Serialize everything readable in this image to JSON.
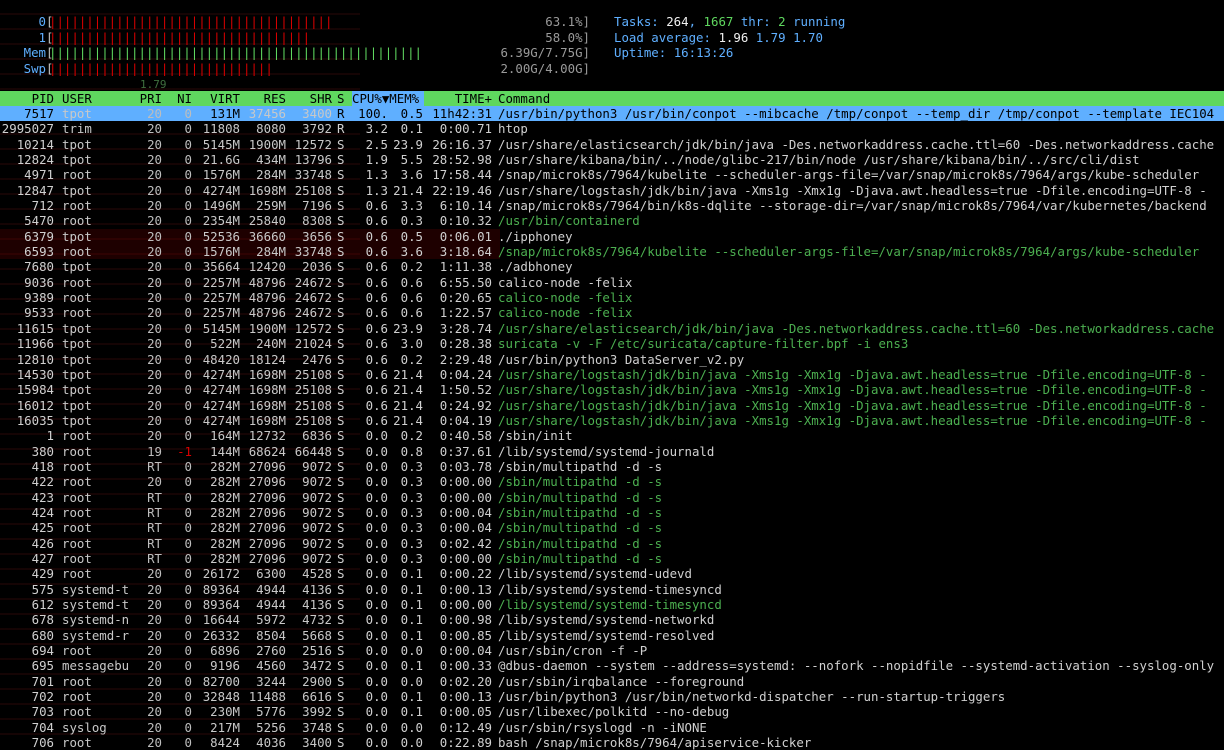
{
  "meters": [
    {
      "label": "0",
      "fraction": 0.631,
      "value": "63.1%]",
      "bar_color": "#d70000"
    },
    {
      "label": "1",
      "fraction": 0.58,
      "value": "58.0%]",
      "bar_color": "#d70000"
    },
    {
      "label": "Mem",
      "fraction": 0.826,
      "value": "6.39G/7.75G]",
      "bar_color": "#5fd75f"
    },
    {
      "label": "Swp",
      "fraction": 0.5,
      "value": "2.00G/4.00G]",
      "bar_color": "#d70000"
    }
  ],
  "summary": {
    "tasks_label": "Tasks: ",
    "tasks": "264",
    "thr_sep": ", ",
    "thr": "1667",
    "thr_label": " thr: ",
    "running": "2",
    "running_label": " running",
    "load_label": "Load average: ",
    "load1": "1.96",
    "load5": "1.79",
    "load15": "1.70",
    "uptime_label": "Uptime: ",
    "uptime": "16:13:26"
  },
  "ghost_text": "1.79",
  "columns": [
    "PID",
    "USER",
    "PRI",
    "NI",
    "VIRT",
    "RES",
    "SHR",
    "S",
    "CPU%▼MEM%",
    "TIME+",
    "Command"
  ],
  "colors": {
    "header_bg": "#5fd75f",
    "selected_bg": "#5fafff",
    "thread": "#4caf50",
    "accent_blue": "#5fafff"
  },
  "processes": [
    {
      "pid": "7517",
      "user": "tpot",
      "pri": "20",
      "ni": "0",
      "virt": "131M",
      "res": "37456",
      "shr": "3400",
      "s": "R",
      "cpu": "100.",
      "mem": "0.5",
      "time": "11h42:31",
      "cmd": "/usr/bin/python3 /usr/bin/conpot --mibcache /tmp/conpot --temp_dir /tmp/conpot --template IEC104",
      "sel": true
    },
    {
      "pid": "2995027",
      "user": "trim",
      "pri": "20",
      "ni": "0",
      "virt": "11808",
      "res": "8080",
      "shr": "3792",
      "s": "R",
      "cpu": "3.2",
      "mem": "0.1",
      "time": "0:00.71",
      "cmd": "htop"
    },
    {
      "pid": "10214",
      "user": "tpot",
      "pri": "20",
      "ni": "0",
      "virt": "5145M",
      "res": "1900M",
      "shr": "12572",
      "s": "S",
      "cpu": "2.5",
      "mem": "23.9",
      "time": "26:16.37",
      "cmd": "/usr/share/elasticsearch/jdk/bin/java -Des.networkaddress.cache.ttl=60 -Des.networkaddress.cache"
    },
    {
      "pid": "12824",
      "user": "tpot",
      "pri": "20",
      "ni": "0",
      "virt": "21.6G",
      "res": "434M",
      "shr": "13796",
      "s": "S",
      "cpu": "1.9",
      "mem": "5.5",
      "time": "28:52.98",
      "cmd": "/usr/share/kibana/bin/../node/glibc-217/bin/node /usr/share/kibana/bin/../src/cli/dist"
    },
    {
      "pid": "4971",
      "user": "root",
      "pri": "20",
      "ni": "0",
      "virt": "1576M",
      "res": "284M",
      "shr": "33748",
      "s": "S",
      "cpu": "1.3",
      "mem": "3.6",
      "time": "17:58.44",
      "cmd": "/snap/microk8s/7964/kubelite --scheduler-args-file=/var/snap/microk8s/7964/args/kube-scheduler"
    },
    {
      "pid": "12847",
      "user": "tpot",
      "pri": "20",
      "ni": "0",
      "virt": "4274M",
      "res": "1698M",
      "shr": "25108",
      "s": "S",
      "cpu": "1.3",
      "mem": "21.4",
      "time": "22:19.46",
      "cmd": "/usr/share/logstash/jdk/bin/java -Xms1g -Xmx1g -Djava.awt.headless=true -Dfile.encoding=UTF-8 -"
    },
    {
      "pid": "712",
      "user": "root",
      "pri": "20",
      "ni": "0",
      "virt": "1496M",
      "res": "259M",
      "shr": "7196",
      "s": "S",
      "cpu": "0.6",
      "mem": "3.3",
      "time": "6:10.14",
      "cmd": "/snap/microk8s/7964/bin/k8s-dqlite --storage-dir=/var/snap/microk8s/7964/var/kubernetes/backend"
    },
    {
      "pid": "5470",
      "user": "root",
      "pri": "20",
      "ni": "0",
      "virt": "2354M",
      "res": "25840",
      "shr": "8308",
      "s": "S",
      "cpu": "0.6",
      "mem": "0.3",
      "time": "0:10.32",
      "cmd": "/usr/bin/containerd",
      "thread": true
    },
    {
      "pid": "6379",
      "user": "tpot",
      "pri": "20",
      "ni": "0",
      "virt": "52536",
      "res": "36660",
      "shr": "3656",
      "s": "S",
      "cpu": "0.6",
      "mem": "0.5",
      "time": "0:06.01",
      "cmd": "./ipphoney",
      "ghost": true
    },
    {
      "pid": "6593",
      "user": "root",
      "pri": "20",
      "ni": "0",
      "virt": "1576M",
      "res": "284M",
      "shr": "33748",
      "s": "S",
      "cpu": "0.6",
      "mem": "3.6",
      "time": "3:18.64",
      "cmd": "/snap/microk8s/7964/kubelite --scheduler-args-file=/var/snap/microk8s/7964/args/kube-scheduler",
      "thread": true,
      "ghost": true
    },
    {
      "pid": "7680",
      "user": "tpot",
      "pri": "20",
      "ni": "0",
      "virt": "35664",
      "res": "12420",
      "shr": "2036",
      "s": "S",
      "cpu": "0.6",
      "mem": "0.2",
      "time": "1:11.38",
      "cmd": "./adbhoney"
    },
    {
      "pid": "9036",
      "user": "root",
      "pri": "20",
      "ni": "0",
      "virt": "2257M",
      "res": "48796",
      "shr": "24672",
      "s": "S",
      "cpu": "0.6",
      "mem": "0.6",
      "time": "6:55.50",
      "cmd": "calico-node -felix"
    },
    {
      "pid": "9389",
      "user": "root",
      "pri": "20",
      "ni": "0",
      "virt": "2257M",
      "res": "48796",
      "shr": "24672",
      "s": "S",
      "cpu": "0.6",
      "mem": "0.6",
      "time": "0:20.65",
      "cmd": "calico-node -felix",
      "thread": true
    },
    {
      "pid": "9533",
      "user": "root",
      "pri": "20",
      "ni": "0",
      "virt": "2257M",
      "res": "48796",
      "shr": "24672",
      "s": "S",
      "cpu": "0.6",
      "mem": "0.6",
      "time": "1:22.57",
      "cmd": "calico-node -felix",
      "thread": true
    },
    {
      "pid": "11615",
      "user": "tpot",
      "pri": "20",
      "ni": "0",
      "virt": "5145M",
      "res": "1900M",
      "shr": "12572",
      "s": "S",
      "cpu": "0.6",
      "mem": "23.9",
      "time": "3:28.74",
      "cmd": "/usr/share/elasticsearch/jdk/bin/java -Des.networkaddress.cache.ttl=60 -Des.networkaddress.cache",
      "thread": true
    },
    {
      "pid": "11966",
      "user": "tpot",
      "pri": "20",
      "ni": "0",
      "virt": "522M",
      "res": "240M",
      "shr": "21024",
      "s": "S",
      "cpu": "0.6",
      "mem": "3.0",
      "time": "0:28.38",
      "cmd": "suricata -v -F /etc/suricata/capture-filter.bpf -i ens3",
      "thread": true
    },
    {
      "pid": "12810",
      "user": "tpot",
      "pri": "20",
      "ni": "0",
      "virt": "48420",
      "res": "18124",
      "shr": "2476",
      "s": "S",
      "cpu": "0.6",
      "mem": "0.2",
      "time": "2:29.48",
      "cmd": "/usr/bin/python3 DataServer_v2.py"
    },
    {
      "pid": "14530",
      "user": "tpot",
      "pri": "20",
      "ni": "0",
      "virt": "4274M",
      "res": "1698M",
      "shr": "25108",
      "s": "S",
      "cpu": "0.6",
      "mem": "21.4",
      "time": "0:04.24",
      "cmd": "/usr/share/logstash/jdk/bin/java -Xms1g -Xmx1g -Djava.awt.headless=true -Dfile.encoding=UTF-8 -",
      "thread": true
    },
    {
      "pid": "15984",
      "user": "tpot",
      "pri": "20",
      "ni": "0",
      "virt": "4274M",
      "res": "1698M",
      "shr": "25108",
      "s": "S",
      "cpu": "0.6",
      "mem": "21.4",
      "time": "1:50.52",
      "cmd": "/usr/share/logstash/jdk/bin/java -Xms1g -Xmx1g -Djava.awt.headless=true -Dfile.encoding=UTF-8 -",
      "thread": true
    },
    {
      "pid": "16012",
      "user": "tpot",
      "pri": "20",
      "ni": "0",
      "virt": "4274M",
      "res": "1698M",
      "shr": "25108",
      "s": "S",
      "cpu": "0.6",
      "mem": "21.4",
      "time": "0:24.92",
      "cmd": "/usr/share/logstash/jdk/bin/java -Xms1g -Xmx1g -Djava.awt.headless=true -Dfile.encoding=UTF-8 -",
      "thread": true
    },
    {
      "pid": "16035",
      "user": "tpot",
      "pri": "20",
      "ni": "0",
      "virt": "4274M",
      "res": "1698M",
      "shr": "25108",
      "s": "S",
      "cpu": "0.6",
      "mem": "21.4",
      "time": "0:04.19",
      "cmd": "/usr/share/logstash/jdk/bin/java -Xms1g -Xmx1g -Djava.awt.headless=true -Dfile.encoding=UTF-8 -",
      "thread": true
    },
    {
      "pid": "1",
      "user": "root",
      "pri": "20",
      "ni": "0",
      "virt": "164M",
      "res": "12732",
      "shr": "6836",
      "s": "S",
      "cpu": "0.0",
      "mem": "0.2",
      "time": "0:40.58",
      "cmd": "/sbin/init"
    },
    {
      "pid": "380",
      "user": "root",
      "pri": "19",
      "ni": "-1",
      "virt": "144M",
      "res": "68624",
      "shr": "66448",
      "s": "S",
      "cpu": "0.0",
      "mem": "0.8",
      "time": "0:37.61",
      "cmd": "/lib/systemd/systemd-journald",
      "neg": true
    },
    {
      "pid": "418",
      "user": "root",
      "pri": "RT",
      "ni": "0",
      "virt": "282M",
      "res": "27096",
      "shr": "9072",
      "s": "S",
      "cpu": "0.0",
      "mem": "0.3",
      "time": "0:03.78",
      "cmd": "/sbin/multipathd -d -s"
    },
    {
      "pid": "422",
      "user": "root",
      "pri": "20",
      "ni": "0",
      "virt": "282M",
      "res": "27096",
      "shr": "9072",
      "s": "S",
      "cpu": "0.0",
      "mem": "0.3",
      "time": "0:00.00",
      "cmd": "/sbin/multipathd -d -s",
      "thread": true
    },
    {
      "pid": "423",
      "user": "root",
      "pri": "RT",
      "ni": "0",
      "virt": "282M",
      "res": "27096",
      "shr": "9072",
      "s": "S",
      "cpu": "0.0",
      "mem": "0.3",
      "time": "0:00.00",
      "cmd": "/sbin/multipathd -d -s",
      "thread": true
    },
    {
      "pid": "424",
      "user": "root",
      "pri": "RT",
      "ni": "0",
      "virt": "282M",
      "res": "27096",
      "shr": "9072",
      "s": "S",
      "cpu": "0.0",
      "mem": "0.3",
      "time": "0:00.04",
      "cmd": "/sbin/multipathd -d -s",
      "thread": true
    },
    {
      "pid": "425",
      "user": "root",
      "pri": "RT",
      "ni": "0",
      "virt": "282M",
      "res": "27096",
      "shr": "9072",
      "s": "S",
      "cpu": "0.0",
      "mem": "0.3",
      "time": "0:00.04",
      "cmd": "/sbin/multipathd -d -s",
      "thread": true
    },
    {
      "pid": "426",
      "user": "root",
      "pri": "RT",
      "ni": "0",
      "virt": "282M",
      "res": "27096",
      "shr": "9072",
      "s": "S",
      "cpu": "0.0",
      "mem": "0.3",
      "time": "0:02.42",
      "cmd": "/sbin/multipathd -d -s",
      "thread": true
    },
    {
      "pid": "427",
      "user": "root",
      "pri": "RT",
      "ni": "0",
      "virt": "282M",
      "res": "27096",
      "shr": "9072",
      "s": "S",
      "cpu": "0.0",
      "mem": "0.3",
      "time": "0:00.00",
      "cmd": "/sbin/multipathd -d -s",
      "thread": true
    },
    {
      "pid": "429",
      "user": "root",
      "pri": "20",
      "ni": "0",
      "virt": "26172",
      "res": "6300",
      "shr": "4528",
      "s": "S",
      "cpu": "0.0",
      "mem": "0.1",
      "time": "0:00.22",
      "cmd": "/lib/systemd/systemd-udevd"
    },
    {
      "pid": "575",
      "user": "systemd-t",
      "pri": "20",
      "ni": "0",
      "virt": "89364",
      "res": "4944",
      "shr": "4136",
      "s": "S",
      "cpu": "0.0",
      "mem": "0.1",
      "time": "0:00.13",
      "cmd": "/lib/systemd/systemd-timesyncd"
    },
    {
      "pid": "612",
      "user": "systemd-t",
      "pri": "20",
      "ni": "0",
      "virt": "89364",
      "res": "4944",
      "shr": "4136",
      "s": "S",
      "cpu": "0.0",
      "mem": "0.1",
      "time": "0:00.00",
      "cmd": "/lib/systemd/systemd-timesyncd",
      "thread": true
    },
    {
      "pid": "678",
      "user": "systemd-n",
      "pri": "20",
      "ni": "0",
      "virt": "16644",
      "res": "5972",
      "shr": "4732",
      "s": "S",
      "cpu": "0.0",
      "mem": "0.1",
      "time": "0:00.98",
      "cmd": "/lib/systemd/systemd-networkd"
    },
    {
      "pid": "680",
      "user": "systemd-r",
      "pri": "20",
      "ni": "0",
      "virt": "26332",
      "res": "8504",
      "shr": "5668",
      "s": "S",
      "cpu": "0.0",
      "mem": "0.1",
      "time": "0:00.85",
      "cmd": "/lib/systemd/systemd-resolved"
    },
    {
      "pid": "694",
      "user": "root",
      "pri": "20",
      "ni": "0",
      "virt": "6896",
      "res": "2760",
      "shr": "2516",
      "s": "S",
      "cpu": "0.0",
      "mem": "0.0",
      "time": "0:00.04",
      "cmd": "/usr/sbin/cron -f -P"
    },
    {
      "pid": "695",
      "user": "messagebu",
      "pri": "20",
      "ni": "0",
      "virt": "9196",
      "res": "4560",
      "shr": "3472",
      "s": "S",
      "cpu": "0.0",
      "mem": "0.1",
      "time": "0:00.33",
      "cmd": "@dbus-daemon --system --address=systemd: --nofork --nopidfile --systemd-activation --syslog-only"
    },
    {
      "pid": "701",
      "user": "root",
      "pri": "20",
      "ni": "0",
      "virt": "82700",
      "res": "3244",
      "shr": "2900",
      "s": "S",
      "cpu": "0.0",
      "mem": "0.0",
      "time": "0:02.20",
      "cmd": "/usr/sbin/irqbalance --foreground"
    },
    {
      "pid": "702",
      "user": "root",
      "pri": "20",
      "ni": "0",
      "virt": "32848",
      "res": "11488",
      "shr": "6616",
      "s": "S",
      "cpu": "0.0",
      "mem": "0.1",
      "time": "0:00.13",
      "cmd": "/usr/bin/python3 /usr/bin/networkd-dispatcher --run-startup-triggers"
    },
    {
      "pid": "703",
      "user": "root",
      "pri": "20",
      "ni": "0",
      "virt": "230M",
      "res": "5776",
      "shr": "3992",
      "s": "S",
      "cpu": "0.0",
      "mem": "0.1",
      "time": "0:00.05",
      "cmd": "/usr/libexec/polkitd --no-debug"
    },
    {
      "pid": "704",
      "user": "syslog",
      "pri": "20",
      "ni": "0",
      "virt": "217M",
      "res": "5256",
      "shr": "3748",
      "s": "S",
      "cpu": "0.0",
      "mem": "0.0",
      "time": "0:12.49",
      "cmd": "/usr/sbin/rsyslogd -n -iNONE"
    },
    {
      "pid": "706",
      "user": "root",
      "pri": "20",
      "ni": "0",
      "virt": "8424",
      "res": "4036",
      "shr": "3400",
      "s": "S",
      "cpu": "0.0",
      "mem": "0.0",
      "time": "0:22.89",
      "cmd": "bash /snap/microk8s/7964/apiservice-kicker"
    }
  ]
}
